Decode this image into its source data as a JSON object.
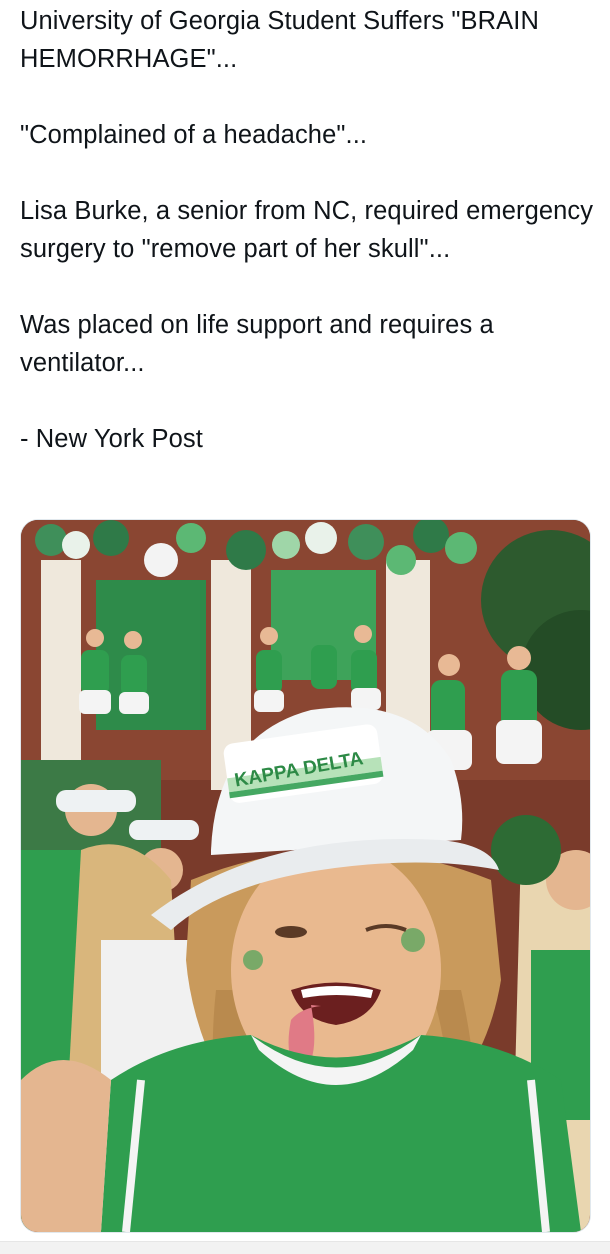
{
  "post": {
    "paragraphs": [
      "University of Georgia Student Suffers \"BRAIN HEMORRHAGE\"...",
      "\"Complained of a headache\"...",
      "Lisa Burke, a senior from NC, required emergency surgery to \"remove part of her skull\"...",
      "Was placed on life support and requires a ventilator...",
      "- New York Post"
    ]
  },
  "media": {
    "hat_text": "KAPPA DELTA",
    "colors": {
      "jersey_green": "#2f9e4f",
      "brick": "#7a3b2b",
      "balloon_green": "#3f8f5a",
      "hat_white": "#f4f6f7"
    }
  }
}
